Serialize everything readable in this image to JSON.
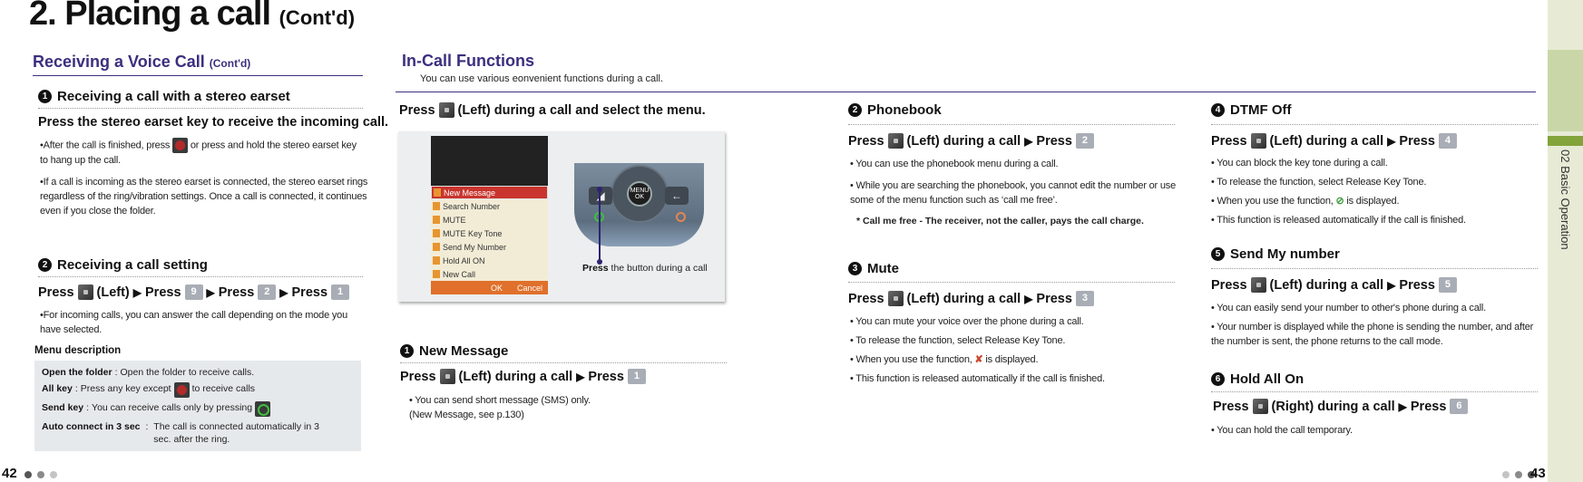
{
  "page_title": {
    "main": "2. Placing a call",
    "cont": "(Cont'd)"
  },
  "left": {
    "section_title": "Receiving a Voice Call",
    "section_cont": "(Cont'd)",
    "item1": {
      "number": "1",
      "title": "Receiving a call with a stereo earset",
      "instruction": "Press the stereo earset key to receive the incoming call.",
      "bullet1_a": "•After the call is finished, press",
      "bullet1_b": "or press and hold the stereo earset key to hang up the call.",
      "bullet1_icon": "end-key-icon",
      "bullet2": "•If a call is incoming as the stereo earset is connected, the stereo earset rings regardless of the ring/vibration settings. Once a call is connected, it continues even if you close the folder."
    },
    "item2": {
      "number": "2",
      "title": "Receiving a call setting",
      "press": "Press",
      "left_label": "(Left)",
      "keys": [
        "9",
        "2",
        "1"
      ],
      "bullet": "•For incoming calls, you can answer the call depending on the mode you have selected.",
      "menu_desc_label": "Menu description",
      "menu_desc": [
        {
          "term": "Open the folder",
          "sep": " : ",
          "desc": "Open the folder to receive calls."
        },
        {
          "term": "All key",
          "sep": " : ",
          "desc_a": "Press any key except",
          "icon": "end-key-icon",
          "desc_b": "to receive calls"
        },
        {
          "term": "Send key",
          "sep": " : ",
          "desc_a": "You can receive calls only by pressing",
          "icon": "send-key-icon"
        },
        {
          "term": "Auto connect in 3 sec",
          "sep": " : ",
          "desc": "The call is connected automatically in 3 sec. after the ring."
        }
      ]
    },
    "page_number": "42"
  },
  "in_call": {
    "section_title": "In-Call Functions",
    "subtitle": "You can use various eonvenient functions during a call.",
    "intro_press": "Press",
    "intro_rest": "(Left) during a call and select the menu.",
    "illustration": {
      "screen_menu": [
        "New Message",
        "Search Number",
        "MUTE",
        "MUTE Key Tone",
        "Send My Number",
        "Hold All ON",
        "New Call"
      ],
      "screen_softkeys": [
        "OK",
        "Cancel"
      ],
      "keypad_ok_top": "MENU",
      "keypad_ok_bottom": "OK",
      "callout_bold": "Press",
      "callout_rest": " the button during a call"
    },
    "items": [
      {
        "number": "1",
        "title": "New Message",
        "press": "Press",
        "side": "(Left) during a call",
        "press2": "Press",
        "key": "1",
        "bullets": [
          "• You can send short message (SMS) only.",
          "(New Message, see p.130)"
        ]
      },
      {
        "number": "2",
        "title": "Phonebook",
        "press": "Press",
        "side": "(Left) during a call",
        "press2": "Press",
        "key": "2",
        "bullets": [
          "• You can use the phonebook menu during a call.",
          "• While you are searching the phonebook, you cannot edit the number or use some of the menu function such as ‘call me free’."
        ],
        "note": "* Call me free - The receiver, not the caller, pays the call charge."
      },
      {
        "number": "3",
        "title": "Mute",
        "press": "Press",
        "side": "(Left) during a call",
        "press2": "Press",
        "key": "3",
        "bullets": [
          "• You can mute your voice over the phone during a call.",
          "• To release the function, select Release Key Tone.",
          "• When you use the function,",
          "• This function is released automatically if the call is finished."
        ],
        "status_icon": "mute-mic-icon",
        "status_suffix": "is displayed."
      },
      {
        "number": "4",
        "title": "DTMF Off",
        "press": "Press",
        "side": "(Left) during a call",
        "press2": "Press",
        "key": "4",
        "bullets": [
          "• You can block the key tone during a call.",
          "• To release the function, select Release Key Tone.",
          "• When you use the function,",
          "• This function is released automatically if the call is finished."
        ],
        "status_icon": "key-tone-off-icon",
        "status_suffix": "is displayed."
      },
      {
        "number": "5",
        "title": "Send My number",
        "press": "Press",
        "side": "(Left) during a call",
        "press2": "Press",
        "key": "5",
        "bullets": [
          "• You can easily send your number to other's phone during a call.",
          "• Your number is displayed while the phone is sending the number, and after the number is sent, the phone returns to the call mode."
        ]
      },
      {
        "number": "6",
        "title": "Hold All On",
        "press": "Press",
        "side": "(Right) during a call",
        "press2": "Press",
        "key": "6",
        "bullets": [
          "• You can hold the call temporary."
        ]
      }
    ],
    "page_number": "43"
  },
  "side_tab": {
    "label": "02 Basic Operation"
  },
  "colors": {
    "accent_purple": "#3b2f7e",
    "tab_green": "#83a33b",
    "tab_bg": "#e7ebd6"
  }
}
